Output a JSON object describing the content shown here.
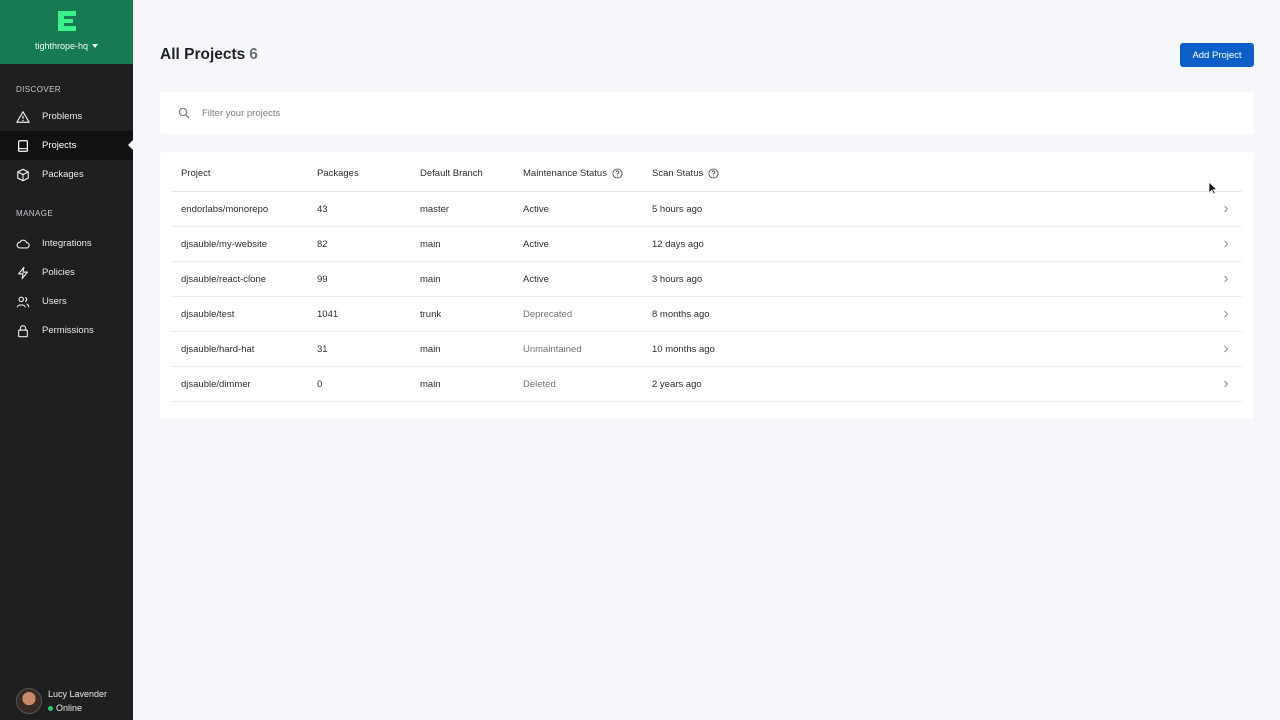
{
  "sidebar": {
    "org": "tighthrope-hq",
    "sections": {
      "discover": "DISCOVER",
      "manage": "MANAGE"
    },
    "discover_items": [
      {
        "label": "Problems",
        "icon": "warning-icon"
      },
      {
        "label": "Projects",
        "icon": "book-icon",
        "active": true
      },
      {
        "label": "Packages",
        "icon": "package-icon"
      }
    ],
    "manage_items": [
      {
        "label": "Integrations",
        "icon": "cloud-icon"
      },
      {
        "label": "Policies",
        "icon": "bolt-icon"
      },
      {
        "label": "Users",
        "icon": "users-icon"
      },
      {
        "label": "Permissions",
        "icon": "lock-icon"
      }
    ],
    "user": {
      "name": "Lucy Lavender",
      "status": "Online"
    }
  },
  "header": {
    "title": "All Projects",
    "count": "6",
    "add_button": "Add Project"
  },
  "search": {
    "placeholder": "Filter your projects"
  },
  "table": {
    "columns": [
      "Project",
      "Packages",
      "Default Branch",
      "Maintenance Status",
      "Scan Status"
    ],
    "rows": [
      {
        "project": "endorlabs/monorepo",
        "packages": "43",
        "branch": "master",
        "maintenance": "Active",
        "scan": "5 hours ago"
      },
      {
        "project": "djsauble/my-website",
        "packages": "82",
        "branch": "main",
        "maintenance": "Active",
        "scan": "12 days ago"
      },
      {
        "project": "djsauble/react-clone",
        "packages": "99",
        "branch": "main",
        "maintenance": "Active",
        "scan": "3 hours ago"
      },
      {
        "project": "djsauble/test",
        "packages": "1041",
        "branch": "trunk",
        "maintenance": "Deprecated",
        "scan": "8 months ago"
      },
      {
        "project": "djsauble/hard-hat",
        "packages": "31",
        "branch": "main",
        "maintenance": "Unmaintained",
        "scan": "10 months ago"
      },
      {
        "project": "djsauble/dimmer",
        "packages": "0",
        "branch": "main",
        "maintenance": "Deleted",
        "scan": "2 years ago"
      }
    ]
  },
  "colors": {
    "brand": "#167a52",
    "sidebar_bg": "#1f1f22",
    "primary_button": "#0b5fc7",
    "online": "#2ecc71"
  }
}
